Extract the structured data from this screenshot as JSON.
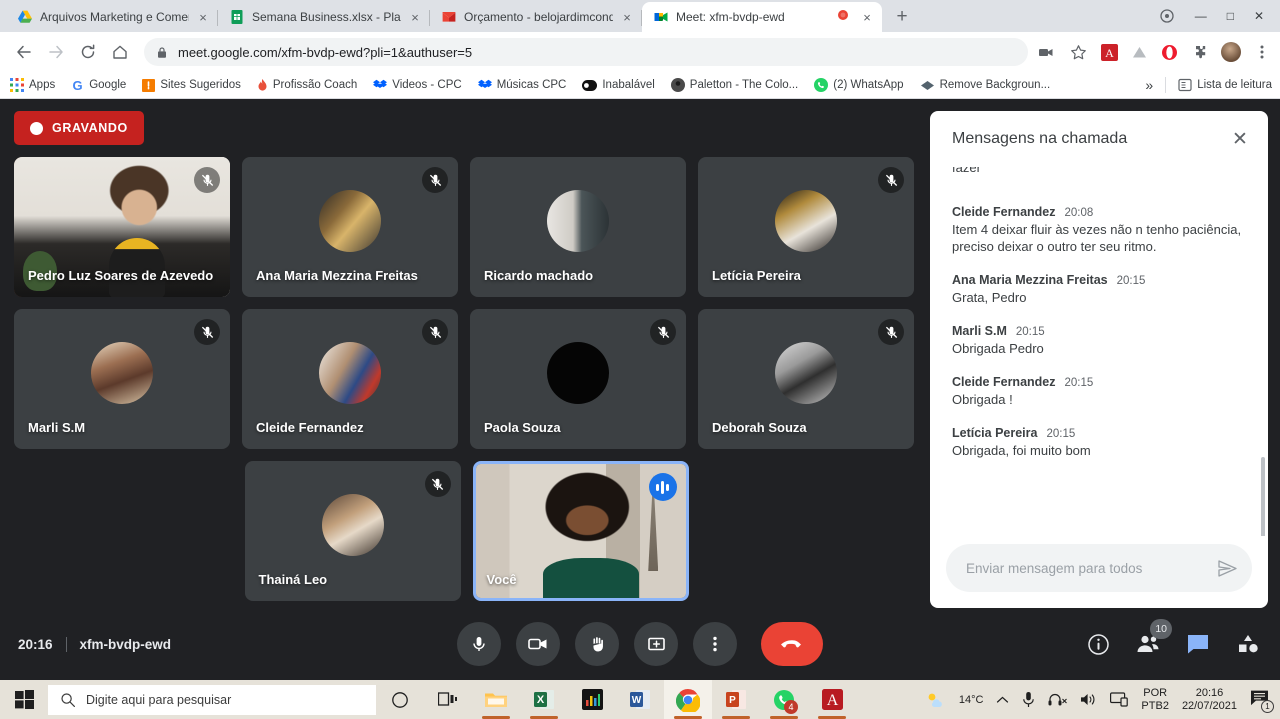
{
  "browser": {
    "tabs": [
      {
        "title": "Arquivos Marketing e Comercial",
        "icon": "google-drive-icon",
        "close": "×",
        "active": false
      },
      {
        "title": "Semana Business.xlsx - Planilhas",
        "icon": "google-sheets-icon",
        "close": "×",
        "active": false
      },
      {
        "title": "Orçamento - belojardimcondomin",
        "icon": "gmail-icon",
        "close": "×",
        "active": false
      },
      {
        "title": "Meet: xfm-bvdp-ewd",
        "icon": "google-meet-icon",
        "close": "×",
        "active": true
      }
    ],
    "new_tab_label": "+",
    "window_controls": {
      "minimize": "—",
      "maximize": "□",
      "close": "✕"
    },
    "url": "meet.google.com/xfm-bvdp-ewd?pli=1&authuser=5",
    "bookmarks": [
      {
        "label": "Apps",
        "icon": "apps-grid-icon"
      },
      {
        "label": "Google",
        "icon": "google-g-icon"
      },
      {
        "label": "Sites Sugeridos",
        "icon": "bookmark-orange-icon"
      },
      {
        "label": "Profissão Coach",
        "icon": "flame-icon"
      },
      {
        "label": "Videos - CPC",
        "icon": "dropbox-icon"
      },
      {
        "label": "Músicas CPC",
        "icon": "dropbox-icon"
      },
      {
        "label": "Inabalável",
        "icon": "black-pill-icon"
      },
      {
        "label": "Paletton - The Colo...",
        "icon": "paletton-icon"
      },
      {
        "label": "(2) WhatsApp",
        "icon": "whatsapp-icon"
      },
      {
        "label": "Remove Backgroun...",
        "icon": "diamond-icon"
      }
    ],
    "bookmarks_overflow": "»",
    "reading_list": "Lista de leitura",
    "toolbar_icons": [
      "camera-icon",
      "star-bookmark-icon",
      "adobe-acrobat-icon",
      "autocad-icon",
      "opera-icon",
      "extensions-puzzle-icon",
      "profile-avatar-icon",
      "chrome-menu-icon"
    ]
  },
  "meet": {
    "recording_label": "GRAVANDO",
    "recording_icon": "record-dot-icon",
    "meeting_time": "20:16",
    "meeting_code": "xfm-bvdp-ewd",
    "participants": [
      {
        "name": "Pedro Luz Soares de Azevedo",
        "muted": true,
        "video": true,
        "self": false,
        "avatar_class": "pedro"
      },
      {
        "name": "Ana Maria Mezzina Freitas",
        "muted": true,
        "video": false,
        "self": false,
        "avatar_class": "ana"
      },
      {
        "name": "Ricardo machado",
        "muted": false,
        "video": false,
        "self": false,
        "avatar_class": "ric"
      },
      {
        "name": "Letícia Pereira",
        "muted": true,
        "video": false,
        "self": false,
        "avatar_class": "let"
      },
      {
        "name": "Marli S.M",
        "muted": true,
        "video": false,
        "self": false,
        "avatar_class": "marli"
      },
      {
        "name": "Cleide Fernandez",
        "muted": true,
        "video": false,
        "self": false,
        "avatar_class": "cle"
      },
      {
        "name": "Paola Souza",
        "muted": true,
        "video": false,
        "self": false,
        "avatar_class": "pao"
      },
      {
        "name": "Deborah Souza",
        "muted": true,
        "video": false,
        "self": false,
        "avatar_class": "deb"
      },
      {
        "name": "Thainá Leo",
        "muted": true,
        "video": false,
        "self": false,
        "avatar_class": "thai"
      },
      {
        "name": "Você",
        "muted": false,
        "video": true,
        "self": true,
        "avatar_class": "self"
      }
    ],
    "controls": [
      {
        "name": "microphone-button",
        "icon": "microphone-icon"
      },
      {
        "name": "camera-button",
        "icon": "video-camera-icon"
      },
      {
        "name": "raise-hand-button",
        "icon": "hand-icon"
      },
      {
        "name": "present-now-button",
        "icon": "present-screen-icon"
      },
      {
        "name": "more-options-button",
        "icon": "three-dots-vertical-icon"
      },
      {
        "name": "leave-call-button",
        "icon": "phone-hangup-icon"
      }
    ],
    "right_controls": [
      {
        "name": "meeting-details-button",
        "icon": "info-circle-icon",
        "badge": ""
      },
      {
        "name": "participants-button",
        "icon": "people-icon",
        "badge": "10"
      },
      {
        "name": "chat-button",
        "icon": "chat-bubble-icon",
        "badge": ""
      },
      {
        "name": "activities-button",
        "icon": "activities-icon",
        "badge": ""
      }
    ]
  },
  "chat": {
    "title": "Mensagens na chamada",
    "close_label": "✕",
    "clipped_top_text": "fazer",
    "messages": [
      {
        "author": "Cleide Fernandez",
        "time": "20:08",
        "text": "Item  4 deixar fluir às vezes não n tenho paciência, preciso deixar o outro ter seu  ritmo."
      },
      {
        "author": "Ana Maria Mezzina Freitas",
        "time": "20:15",
        "text": "Grata, Pedro"
      },
      {
        "author": "Marli S.M",
        "time": "20:15",
        "text": "Obrigada Pedro"
      },
      {
        "author": "Cleide Fernandez",
        "time": "20:15",
        "text": "Obrigada !"
      },
      {
        "author": "Letícia Pereira",
        "time": "20:15",
        "text": "Obrigada, foi muito bom"
      }
    ],
    "input_placeholder": "Enviar mensagem para todos",
    "send_icon": "send-arrow-icon"
  },
  "taskbar": {
    "start_icon": "windows-logo-icon",
    "search_placeholder": "Digite aqui para pesquisar",
    "search_icon": "magnifier-icon",
    "cortana_icon": "cortana-circle-icon",
    "task_view_icon": "task-view-icon",
    "apps": [
      {
        "name": "file-explorer",
        "icon": "folder-icon",
        "active": false,
        "running": true
      },
      {
        "name": "excel",
        "icon": "excel-icon",
        "active": false,
        "running": true
      },
      {
        "name": "media-app",
        "icon": "media-icon",
        "active": false,
        "running": false
      },
      {
        "name": "word",
        "icon": "word-icon",
        "active": false,
        "running": false
      },
      {
        "name": "chrome",
        "icon": "chrome-icon",
        "active": true,
        "running": true
      },
      {
        "name": "powerpoint",
        "icon": "powerpoint-icon",
        "active": false,
        "running": true
      },
      {
        "name": "whatsapp",
        "icon": "whatsapp-icon",
        "active": false,
        "running": true,
        "badge": "4"
      },
      {
        "name": "acrobat",
        "icon": "acrobat-icon",
        "active": false,
        "running": true
      }
    ],
    "weather_temp": "14°C",
    "weather_icon": "sun-cloud-icon",
    "tray_icons": [
      "chevron-up-icon",
      "microphone-icon",
      "headset-muted-icon",
      "volume-icon",
      "display-icon"
    ],
    "language": "POR",
    "keyboard": "PTB2",
    "clock_time": "20:16",
    "clock_date": "22/07/2021",
    "notification_count": "1"
  }
}
